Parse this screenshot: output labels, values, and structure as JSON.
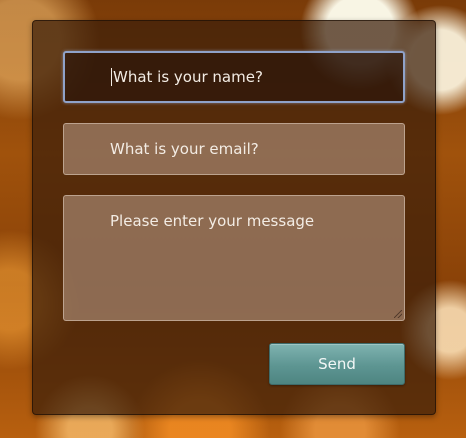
{
  "form": {
    "name_placeholder": "What is your name?",
    "email_placeholder": "What is your email?",
    "message_placeholder": "Please enter your message",
    "send_label": "Send"
  },
  "colors": {
    "focus_border": "#8fa2c9",
    "button_top": "#7fb3b0",
    "button_bottom": "#4e8581"
  }
}
